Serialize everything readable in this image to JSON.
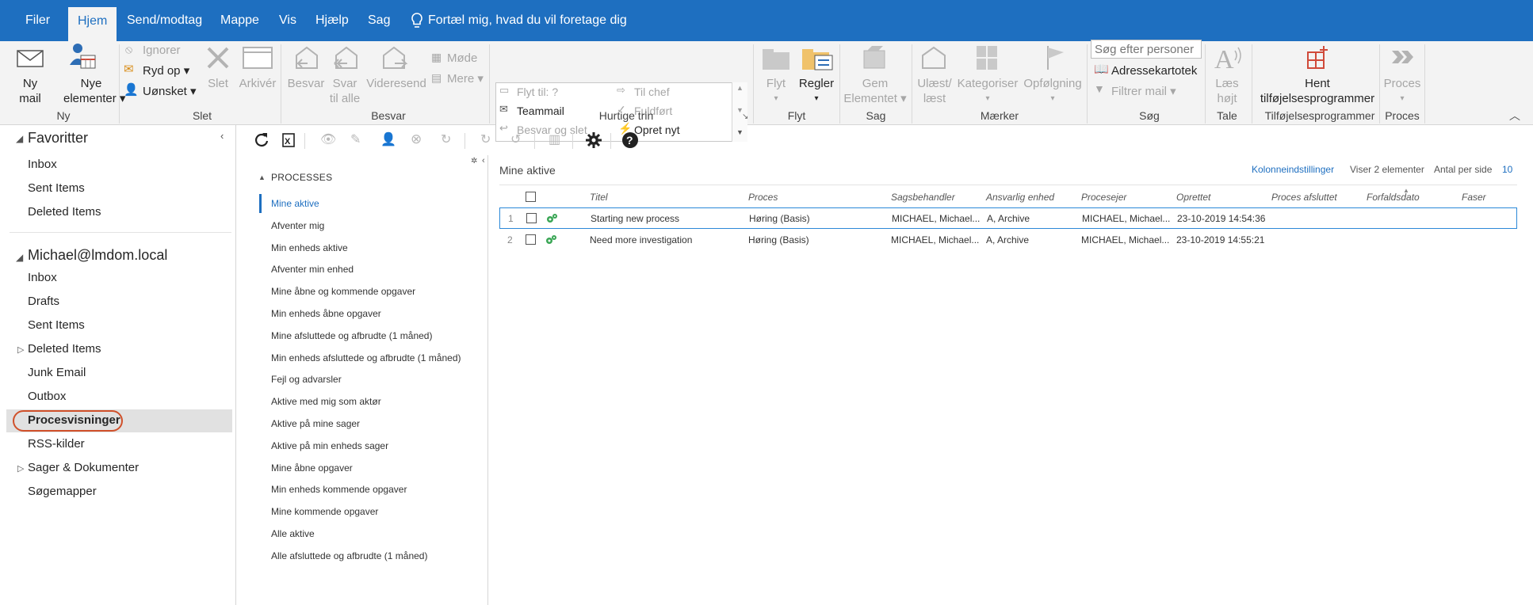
{
  "menu": {
    "items": [
      "Filer",
      "Hjem",
      "Send/modtag",
      "Mappe",
      "Vis",
      "Hjælp",
      "Sag"
    ],
    "active": "Hjem",
    "tell_me": "Fortæl mig, hvad du vil foretage dig"
  },
  "ribbon": {
    "ny": {
      "ny_mail": "Ny\nmail",
      "ny_mail_l1": "Ny",
      "ny_mail_l2": "mail",
      "nye_l1": "Nye",
      "nye_l2": "elementer",
      "group": "Ny"
    },
    "slet": {
      "ignorer": "Ignorer",
      "ryd_op": "Ryd op",
      "uonsket": "Uønsket",
      "slet": "Slet",
      "arkiver": "Arkivér",
      "group": "Slet"
    },
    "besvar": {
      "besvar": "Besvar",
      "svar_l1": "Svar",
      "svar_l2": "til alle",
      "videresend": "Videresend",
      "mode": "Møde",
      "mere": "Mere",
      "group": "Besvar"
    },
    "hurtige": {
      "flyt_til": "Flyt til: ?",
      "til_chef": "Til chef",
      "teammail": "Teammail",
      "fuldfort": "Fuldført",
      "besvar_slet": "Besvar og slet",
      "opret_nyt": "Opret nyt",
      "group": "Hurtige trin"
    },
    "flyt": {
      "flyt": "Flyt",
      "regler": "Regler",
      "group": "Flyt"
    },
    "sag": {
      "gem_l1": "Gem",
      "gem_l2": "Elementet",
      "group": "Sag"
    },
    "maerker": {
      "ulaest_l1": "Ulæst/",
      "ulaest_l2": "læst",
      "kategoriser": "Kategoriser",
      "opfolgning": "Opfølgning",
      "group": "Mærker"
    },
    "sog": {
      "search_placeholder": "Søg efter personer",
      "adressekartotek": "Adressekartotek",
      "filtrer": "Filtrer mail",
      "group": "Søg"
    },
    "tale": {
      "laes_l1": "Læs",
      "laes_l2": "højt",
      "group": "Tale"
    },
    "tilfoj": {
      "hent_l1": "Hent",
      "hent_l2": "tilføjelsesprogrammer",
      "group": "Tilføjelsesprogrammer"
    },
    "proces": {
      "proces": "Proces",
      "group": "Proces"
    }
  },
  "folders": {
    "favorites_title": "Favoritter",
    "favorites": [
      "Inbox",
      "Sent Items",
      "Deleted Items"
    ],
    "account_title": "Michael@lmdom.local",
    "account_items": [
      "Inbox",
      "Drafts",
      "Sent Items",
      "Deleted Items",
      "Junk Email",
      "Outbox",
      "Procesvisninger",
      "RSS-kilder",
      "Sager & Dokumenter",
      "Søgemapper"
    ],
    "selected": "Procesvisninger"
  },
  "process_nav": {
    "header": "PROCESSES",
    "items": [
      "Mine aktive",
      "Afventer mig",
      "Min enheds aktive",
      "Afventer min enhed",
      "Mine åbne og kommende opgaver",
      "Min enheds åbne opgaver",
      "Mine afsluttede og afbrudte (1 måned)",
      "Min enheds afsluttede og afbrudte (1 måned)",
      "Fejl og advarsler",
      "Aktive med mig som aktør",
      "Aktive på mine sager",
      "Aktive på min enheds sager",
      "Mine åbne opgaver",
      "Min enheds kommende opgaver",
      "Mine kommende opgaver",
      "Alle aktive",
      "Alle afsluttede og afbrudte (1 måned)"
    ],
    "active": "Mine aktive"
  },
  "grid": {
    "title": "Mine aktive",
    "column_settings": "Kolonneindstillinger",
    "showing": "Viser 2 elementer",
    "per_page_label": "Antal per side",
    "per_page_value": "10",
    "columns": [
      "Titel",
      "Proces",
      "Sagsbehandler",
      "Ansvarlig enhed",
      "Procesejer",
      "Oprettet",
      "Proces afsluttet",
      "Forfaldsdato",
      "Faser"
    ],
    "rows": [
      {
        "num": "1",
        "titel": "Starting new process",
        "proces": "Høring (Basis)",
        "sagsbehandler": "MICHAEL, Michael...",
        "enhed": "A, Archive",
        "procesejer": "MICHAEL, Michael...",
        "oprettet": "23-10-2019 14:54:36"
      },
      {
        "num": "2",
        "titel": "Need more investigation",
        "proces": "Høring (Basis)",
        "sagsbehandler": "MICHAEL, Michael...",
        "enhed": "A, Archive",
        "procesejer": "MICHAEL, Michael...",
        "oprettet": "23-10-2019 14:55:21"
      }
    ]
  },
  "colors": {
    "accent": "#1e6fc0",
    "selection_ring": "#d0502a",
    "status_green": "#3aa655"
  }
}
